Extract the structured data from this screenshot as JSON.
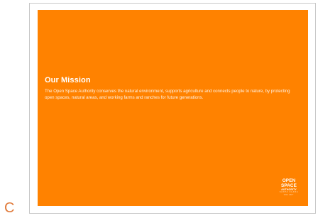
{
  "sidebar": {
    "slide_letter": "C"
  },
  "slide": {
    "background_color": "#ff8200",
    "title": "Our Mission",
    "body": "The Open Space Authority conserves the natural environment, supports agriculture and connects people to nature, by protecting open spaces, natural areas, and working farms and ranches for future generations.",
    "logo": {
      "line1": "OPEN",
      "line2": "SPACE",
      "line3": "AUTHORITY",
      "line4": "SANTA CLARA",
      "line5": "VALLEY"
    }
  }
}
